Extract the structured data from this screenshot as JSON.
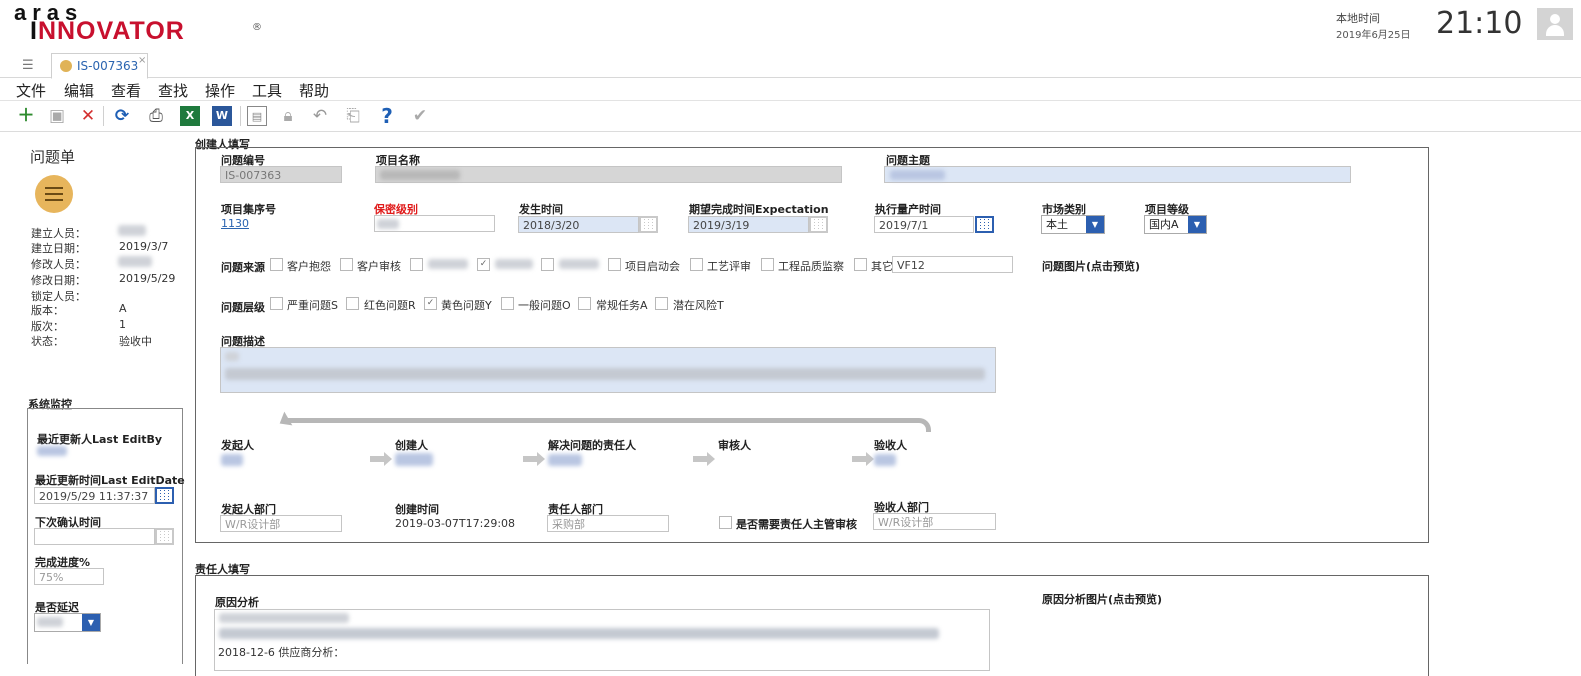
{
  "header": {
    "logo_top": "aras",
    "logo_main_1": "I",
    "logo_main_2": "NNOVATOR",
    "logo_reg": "®",
    "clock_label": "本地时间",
    "clock_date": "2019年6月25日",
    "clock_time": "21:10"
  },
  "tab": {
    "label": "IS-007363",
    "close": "×"
  },
  "menu": [
    "文件",
    "编辑",
    "查看",
    "查找",
    "操作",
    "工具",
    "帮助"
  ],
  "toolbar_icons": [
    "new-icon",
    "save-icon",
    "delete-icon",
    "refresh-icon",
    "print-icon",
    "excel-icon",
    "word-icon",
    "preview-icon",
    "lock-icon",
    "undo-icon",
    "clipboard-icon",
    "help-icon",
    "check-icon"
  ],
  "sidebar": {
    "title": "问题单",
    "meta": [
      {
        "k": "建立人员：",
        "v": ""
      },
      {
        "k": "建立日期：",
        "v": "2019/3/7"
      },
      {
        "k": "修改人员：",
        "v": ""
      },
      {
        "k": "修改日期：",
        "v": "2019/5/29"
      },
      {
        "k": "锁定人员：",
        "v": ""
      },
      {
        "k": "版本：",
        "v": "A"
      },
      {
        "k": "版次：",
        "v": "1"
      },
      {
        "k": "状态：",
        "v": "验收中"
      }
    ],
    "monitor": {
      "title": "系统监控",
      "last_edit_by": "最近更新人Last EditBy",
      "last_edit_date_label": "最近更新时间Last EditDate",
      "last_edit_date": "2019/5/29 11:37:37",
      "next_confirm_label": "下次确认时间",
      "progress_label": "完成进度%",
      "progress_value": "75%",
      "delayed_label": "是否延迟"
    }
  },
  "creator_section": {
    "title": "创建人填写",
    "issue_no_label": "问题编号",
    "issue_no": "IS-007363",
    "project_name_label": "项目名称",
    "issue_subject_label": "问题主题",
    "project_set_label": "项目集序号",
    "project_set": "1130",
    "secrecy_label": "保密级别",
    "occur_time_label": "发生时间",
    "occur_time": "2018/3/20",
    "expect_time_label": "期望完成时间Expectation",
    "expect_time": "2019/3/19",
    "mass_prod_label": "执行量产时间",
    "mass_prod": "2019/7/1",
    "market_label": "市场类别",
    "market_value": "本土",
    "level_label": "项目等级",
    "level_value": "国内A",
    "source_label": "问题来源",
    "sources": [
      "客户抱怨",
      "客户审核",
      "",
      "",
      "",
      "项目启动会",
      "工艺评审",
      "工程品质监察",
      "其它"
    ],
    "source_other_value": "VF12",
    "image_label": "问题图片(点击预览)",
    "tier_label": "问题层级",
    "tiers": [
      "严重问题S",
      "红色问题R",
      "黄色问题Y",
      "一般问题O",
      "常规任务A",
      "潜在风险T"
    ],
    "desc_label": "问题描述",
    "flow": [
      "发起人",
      "创建人",
      "解决问题的责任人",
      "审核人",
      "验收人"
    ],
    "initiator_dept_label": "发起人部门",
    "initiator_dept": "W/R设计部",
    "create_time_label": "创建时间",
    "create_time": "2019-03-07T17:29:08",
    "resp_dept_label": "责任人部门",
    "resp_dept": "采购部",
    "need_review_label": "是否需要责任人主管审核",
    "acceptor_dept_label": "验收人部门",
    "acceptor_dept": "W/R设计部"
  },
  "resp_section": {
    "title": "责任人填写",
    "cause_label": "原因分析",
    "cause_image_label": "原因分析图片(点击预览)",
    "cause_text_line": "2018-12-6 供应商分析："
  }
}
